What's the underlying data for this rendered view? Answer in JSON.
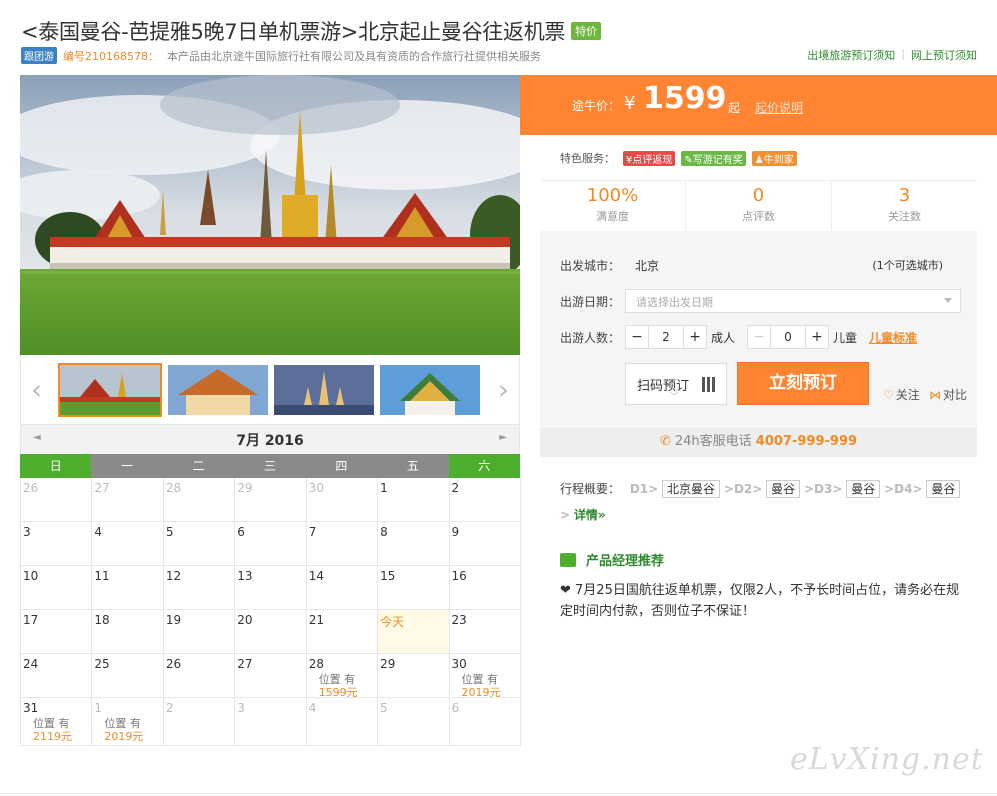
{
  "header": {
    "title": "<泰国曼谷-芭提雅5晚7日单机票游>北京起止曼谷往返机票",
    "special_badge": "特价",
    "group_tag": "跟团游",
    "code": "编号210168578：",
    "description": "本产品由北京途牛国际旅行社有限公司及具有资质的合作旅行社提供相关服务",
    "links": [
      "出境旅游预订须知",
      "网上预订须知"
    ]
  },
  "gallery": {
    "prev_icon": "‹",
    "next_icon": "›"
  },
  "calendar": {
    "month_title": "7月  2016",
    "prev": "◄",
    "next": "►",
    "weekdays": [
      "日",
      "一",
      "二",
      "三",
      "四",
      "五",
      "六"
    ],
    "cells": [
      {
        "d": "26",
        "dim": true
      },
      {
        "d": "27",
        "dim": true
      },
      {
        "d": "28",
        "dim": true
      },
      {
        "d": "29",
        "dim": true
      },
      {
        "d": "30",
        "dim": true
      },
      {
        "d": "1"
      },
      {
        "d": "2"
      },
      {
        "d": "3"
      },
      {
        "d": "4"
      },
      {
        "d": "5"
      },
      {
        "d": "6"
      },
      {
        "d": "7"
      },
      {
        "d": "8"
      },
      {
        "d": "9"
      },
      {
        "d": "10"
      },
      {
        "d": "11"
      },
      {
        "d": "12"
      },
      {
        "d": "13"
      },
      {
        "d": "14"
      },
      {
        "d": "15"
      },
      {
        "d": "16"
      },
      {
        "d": "17"
      },
      {
        "d": "18"
      },
      {
        "d": "19"
      },
      {
        "d": "20"
      },
      {
        "d": "21"
      },
      {
        "d": "今天",
        "today": true
      },
      {
        "d": "23"
      },
      {
        "d": "24"
      },
      {
        "d": "25"
      },
      {
        "d": "26"
      },
      {
        "d": "27"
      },
      {
        "d": "28",
        "pos": "位置 有",
        "price": "1599元"
      },
      {
        "d": "29"
      },
      {
        "d": "30",
        "pos": "位置 有",
        "price": "2019元"
      },
      {
        "d": "31",
        "pos": "位置 有",
        "price": "2119元"
      },
      {
        "d": "1",
        "dim": true,
        "pos": "位置 有",
        "price": "2019元"
      },
      {
        "d": "2",
        "dim": true
      },
      {
        "d": "3",
        "dim": true
      },
      {
        "d": "4",
        "dim": true
      },
      {
        "d": "5",
        "dim": true
      },
      {
        "d": "6",
        "dim": true
      }
    ]
  },
  "price": {
    "label": "途牛价：",
    "currency": "¥",
    "amount": "1599",
    "suffix": "起",
    "explain": "起价说明"
  },
  "features": {
    "label": "特色服务：",
    "tags": [
      {
        "text": "¥点评返现",
        "color": "#e84a4a"
      },
      {
        "text": "✎写游记有奖",
        "color": "#6bb944"
      },
      {
        "text": "♟牛到家",
        "color": "#f29133"
      }
    ]
  },
  "stats": [
    {
      "value": "100%",
      "label": "满意度"
    },
    {
      "value": "0",
      "label": "点评数"
    },
    {
      "value": "3",
      "label": "关注数"
    }
  ],
  "booking": {
    "city_label": "出发城市：",
    "city_value": "北京",
    "city_count": "(1个可选城市)",
    "date_label": "出游日期：",
    "date_placeholder": "请选择出发日期",
    "people_label": "出游人数：",
    "adult_count": "2",
    "adult_label": "成人",
    "child_count": "0",
    "child_label": "儿童",
    "child_standard": "儿童标准",
    "scan_button": "扫码预订",
    "book_button": "立刻预订",
    "follow": "关注",
    "compare": "对比"
  },
  "hotline": {
    "label": "24h客服电话",
    "number": "4007-999-999"
  },
  "itinerary": {
    "label": "行程概要：",
    "days": [
      {
        "day": "D1>",
        "city": "北京曼谷"
      },
      {
        "day": ">D2>",
        "city": "曼谷"
      },
      {
        "day": ">D3>",
        "city": "曼谷"
      },
      {
        "day": ">D4>",
        "city": "曼谷"
      }
    ],
    "tail": ">",
    "more": "详情»"
  },
  "recommend": {
    "title": "产品经理推荐",
    "text": "❤ 7月25日国航往返单机票，仅限2人，不予长时间占位，请务必在规定时间内付款，否则位子不保证！"
  },
  "watermark": "eLvXing.net"
}
